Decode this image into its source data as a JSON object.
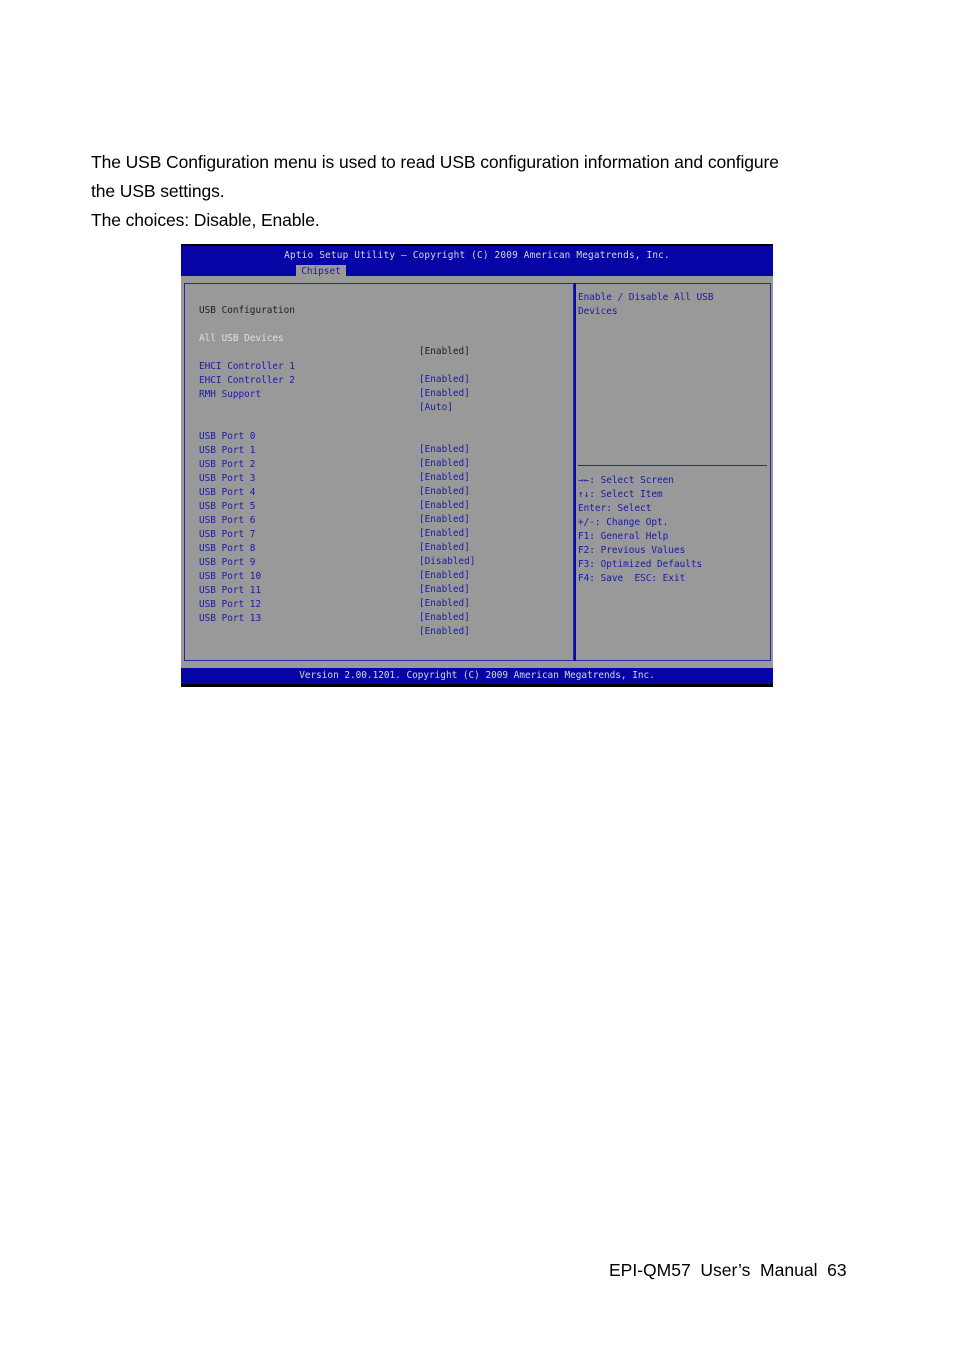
{
  "document": {
    "intro_lines": [
      "The USB Configuration menu is used to read USB configuration information and configure",
      "the USB settings.",
      "The choices: Disable, Enable."
    ],
    "page_footer": "EPI-QM57  User’s  Manual  63"
  },
  "bios": {
    "title": "Aptio Setup Utility – Copyright (C) 2009 American Megatrends, Inc.",
    "active_tab": "Chipset",
    "section_heading": "USB Configuration",
    "items": [
      {
        "label": "All USB Devices",
        "value": "[Enabled]",
        "selected": true
      },
      {
        "label": "EHCI Controller 1",
        "value": "[Enabled]"
      },
      {
        "label": "EHCI Controller 2",
        "value": "[Enabled]"
      },
      {
        "label": "RMH Support",
        "value": "[Auto]"
      },
      {
        "label": "USB Port 0",
        "value": "[Enabled]"
      },
      {
        "label": "USB Port 1",
        "value": "[Enabled]"
      },
      {
        "label": "USB Port 2",
        "value": "[Enabled]"
      },
      {
        "label": "USB Port 3",
        "value": "[Enabled]"
      },
      {
        "label": "USB Port 4",
        "value": "[Enabled]"
      },
      {
        "label": "USB Port 5",
        "value": "[Enabled]"
      },
      {
        "label": "USB Port 6",
        "value": "[Enabled]"
      },
      {
        "label": "USB Port 7",
        "value": "[Enabled]"
      },
      {
        "label": "USB Port 8",
        "value": "[Disabled]"
      },
      {
        "label": "USB Port 9",
        "value": "[Enabled]"
      },
      {
        "label": "USB Port 10",
        "value": "[Enabled]"
      },
      {
        "label": "USB Port 11",
        "value": "[Enabled]"
      },
      {
        "label": "USB Port 12",
        "value": "[Enabled]"
      },
      {
        "label": "USB Port 13",
        "value": "[Enabled]"
      }
    ],
    "help_text": [
      "Enable / Disable All USB",
      "Devices"
    ],
    "key_help": [
      "→←: Select Screen",
      "↑↓: Select Item",
      "Enter: Select",
      "+/-: Change Opt.",
      "F1: General Help",
      "F2: Previous Values",
      "F3: Optimized Defaults",
      "F4: Save  ESC: Exit"
    ],
    "footer": "Version 2.00.1201. Copyright (C) 2009 American Megatrends, Inc.",
    "colors": {
      "header_blue": "#0505a6",
      "body_gray": "#999999",
      "text_blue": "#1a1aa6",
      "selected_text": "#e0e0e0"
    }
  }
}
